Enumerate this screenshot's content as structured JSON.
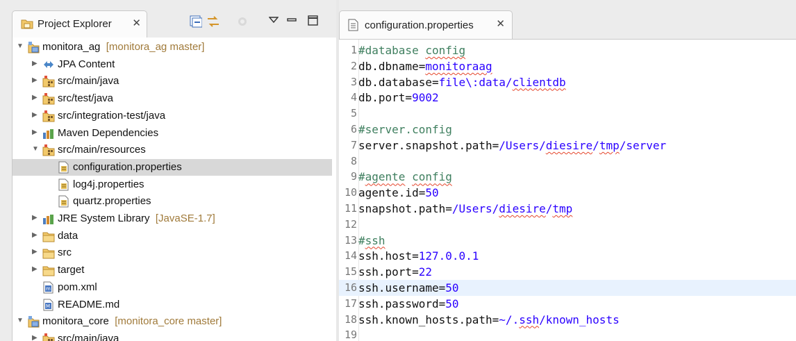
{
  "explorer": {
    "tab_label": "Project Explorer",
    "close_glyph": "✕",
    "toolbar_icons": [
      "collapse-all-icon",
      "link-with-editor-icon",
      "filter-icon",
      "view-menu-icon",
      "minimize-icon",
      "maximize-icon"
    ],
    "rows": [
      {
        "text": "monitora_ag",
        "decoration": "[monitora_ag master]",
        "indent": 0,
        "expanded": true,
        "icon": "project-icon"
      },
      {
        "text": "JPA Content",
        "decoration": "",
        "indent": 1,
        "expanded": false,
        "icon": "jpa-icon"
      },
      {
        "text": "src/main/java",
        "decoration": "",
        "indent": 1,
        "expanded": false,
        "icon": "source-folder-icon"
      },
      {
        "text": "src/test/java",
        "decoration": "",
        "indent": 1,
        "expanded": false,
        "icon": "source-folder-icon"
      },
      {
        "text": "src/integration-test/java",
        "decoration": "",
        "indent": 1,
        "expanded": false,
        "icon": "source-folder-icon"
      },
      {
        "text": "Maven Dependencies",
        "decoration": "",
        "indent": 1,
        "expanded": false,
        "icon": "library-icon"
      },
      {
        "text": "src/main/resources",
        "decoration": "",
        "indent": 1,
        "expanded": true,
        "icon": "source-folder-icon"
      },
      {
        "text": "configuration.properties",
        "decoration": "",
        "indent": 2,
        "selected": true,
        "icon": "properties-file-icon"
      },
      {
        "text": "log4j.properties",
        "decoration": "",
        "indent": 2,
        "icon": "properties-file-icon"
      },
      {
        "text": "quartz.properties",
        "decoration": "",
        "indent": 2,
        "icon": "properties-file-icon"
      },
      {
        "text": "JRE System Library",
        "decoration": "[JavaSE-1.7]",
        "indent": 1,
        "expanded": false,
        "icon": "library-icon"
      },
      {
        "text": "data",
        "decoration": "",
        "indent": 1,
        "expanded": false,
        "icon": "folder-icon"
      },
      {
        "text": "src",
        "decoration": "",
        "indent": 1,
        "expanded": false,
        "icon": "folder-icon"
      },
      {
        "text": "target",
        "decoration": "",
        "indent": 1,
        "expanded": false,
        "icon": "folder-icon"
      },
      {
        "text": "pom.xml",
        "decoration": "",
        "indent": 1,
        "icon": "xml-file-icon"
      },
      {
        "text": "README.md",
        "decoration": "",
        "indent": 1,
        "icon": "markdown-file-icon"
      },
      {
        "text": "monitora_core",
        "decoration": "[monitora_core master]",
        "indent": 0,
        "expanded": true,
        "icon": "project-icon"
      },
      {
        "text": "src/main/java",
        "decoration": "",
        "indent": 1,
        "expanded": false,
        "icon": "source-folder-icon"
      }
    ]
  },
  "editor": {
    "tab_label": "configuration.properties",
    "close_glyph": "✕",
    "highlighted_line": 16,
    "lines": [
      {
        "n": "1",
        "parts": [
          {
            "t": "#database ",
            "c": "cm"
          },
          {
            "t": "config",
            "c": "cm sq"
          }
        ]
      },
      {
        "n": "2",
        "parts": [
          {
            "t": "db.dbname=",
            "c": ""
          },
          {
            "t": "monitoraag",
            "c": "val sq"
          }
        ]
      },
      {
        "n": "3",
        "parts": [
          {
            "t": "db.database=",
            "c": ""
          },
          {
            "t": "file\\:data/",
            "c": "val"
          },
          {
            "t": "clientdb",
            "c": "val sq"
          }
        ]
      },
      {
        "n": "4",
        "parts": [
          {
            "t": "db.port=",
            "c": ""
          },
          {
            "t": "9002",
            "c": "val"
          }
        ]
      },
      {
        "n": "5",
        "parts": []
      },
      {
        "n": "6",
        "parts": [
          {
            "t": "#server.config",
            "c": "cm"
          }
        ]
      },
      {
        "n": "7",
        "parts": [
          {
            "t": "server.snapshot.path=",
            "c": ""
          },
          {
            "t": "/Users/",
            "c": "val"
          },
          {
            "t": "diesire",
            "c": "val sq"
          },
          {
            "t": "/",
            "c": "val"
          },
          {
            "t": "tmp",
            "c": "val sq"
          },
          {
            "t": "/server",
            "c": "val"
          }
        ]
      },
      {
        "n": "8",
        "parts": []
      },
      {
        "n": "9",
        "parts": [
          {
            "t": "#",
            "c": "cm"
          },
          {
            "t": "agente",
            "c": "cm sq"
          },
          {
            "t": " ",
            "c": "cm"
          },
          {
            "t": "config",
            "c": "cm sq"
          }
        ]
      },
      {
        "n": "10",
        "parts": [
          {
            "t": "agente.id=",
            "c": ""
          },
          {
            "t": "50",
            "c": "val"
          }
        ]
      },
      {
        "n": "11",
        "parts": [
          {
            "t": "snapshot.path=",
            "c": ""
          },
          {
            "t": "/Users/",
            "c": "val"
          },
          {
            "t": "diesire",
            "c": "val sq"
          },
          {
            "t": "/",
            "c": "val"
          },
          {
            "t": "tmp",
            "c": "val sq"
          }
        ]
      },
      {
        "n": "12",
        "parts": []
      },
      {
        "n": "13",
        "parts": [
          {
            "t": "#",
            "c": "cm"
          },
          {
            "t": "ssh",
            "c": "cm sq"
          }
        ]
      },
      {
        "n": "14",
        "parts": [
          {
            "t": "ssh.host=",
            "c": ""
          },
          {
            "t": "127.0.0.1",
            "c": "val"
          }
        ]
      },
      {
        "n": "15",
        "parts": [
          {
            "t": "ssh.port=",
            "c": ""
          },
          {
            "t": "22",
            "c": "val"
          }
        ]
      },
      {
        "n": "16",
        "parts": [
          {
            "t": "ssh.username=",
            "c": ""
          },
          {
            "t": "50",
            "c": "val"
          }
        ]
      },
      {
        "n": "17",
        "parts": [
          {
            "t": "ssh.password=",
            "c": ""
          },
          {
            "t": "50",
            "c": "val"
          }
        ]
      },
      {
        "n": "18",
        "parts": [
          {
            "t": "ssh.known_hosts.path=",
            "c": ""
          },
          {
            "t": "~/.",
            "c": "val"
          },
          {
            "t": "ssh",
            "c": "val sq"
          },
          {
            "t": "/known_hosts",
            "c": "val"
          }
        ]
      },
      {
        "n": "19",
        "parts": []
      }
    ]
  },
  "colors": {
    "comment": "#3f7f5f",
    "value": "#2a00ff",
    "selection": "#d8d8d8",
    "current_line": "#e8f2fe",
    "squiggle": "#e5452b",
    "decoration": "#a07a3a"
  }
}
